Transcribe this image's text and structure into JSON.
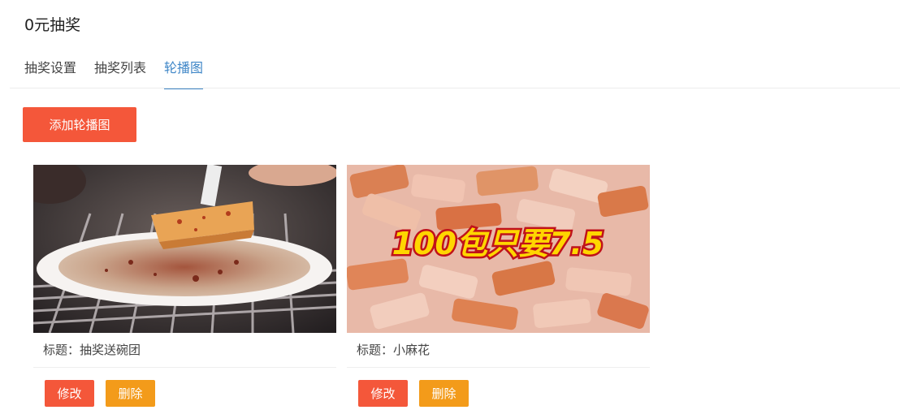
{
  "header": {
    "title": "0元抽奖"
  },
  "tabs": [
    {
      "label": "抽奖设置",
      "active": false
    },
    {
      "label": "抽奖列表",
      "active": false
    },
    {
      "label": "轮播图",
      "active": true
    }
  ],
  "toolbar": {
    "add_label": "添加轮播图"
  },
  "cards": [
    {
      "image": "food-bowl-photo",
      "title_text": "标题：抽奖送碗团",
      "edit_label": "修改",
      "delete_label": "删除"
    },
    {
      "image": "snack-packs-photo",
      "banner_text": "100包只要7.5",
      "title_text": "标题：小麻花",
      "edit_label": "修改",
      "delete_label": "删除"
    }
  ],
  "colors": {
    "accent_blue": "#3e86c7",
    "primary_red": "#f4573a",
    "warning_orange": "#f39b1a"
  }
}
